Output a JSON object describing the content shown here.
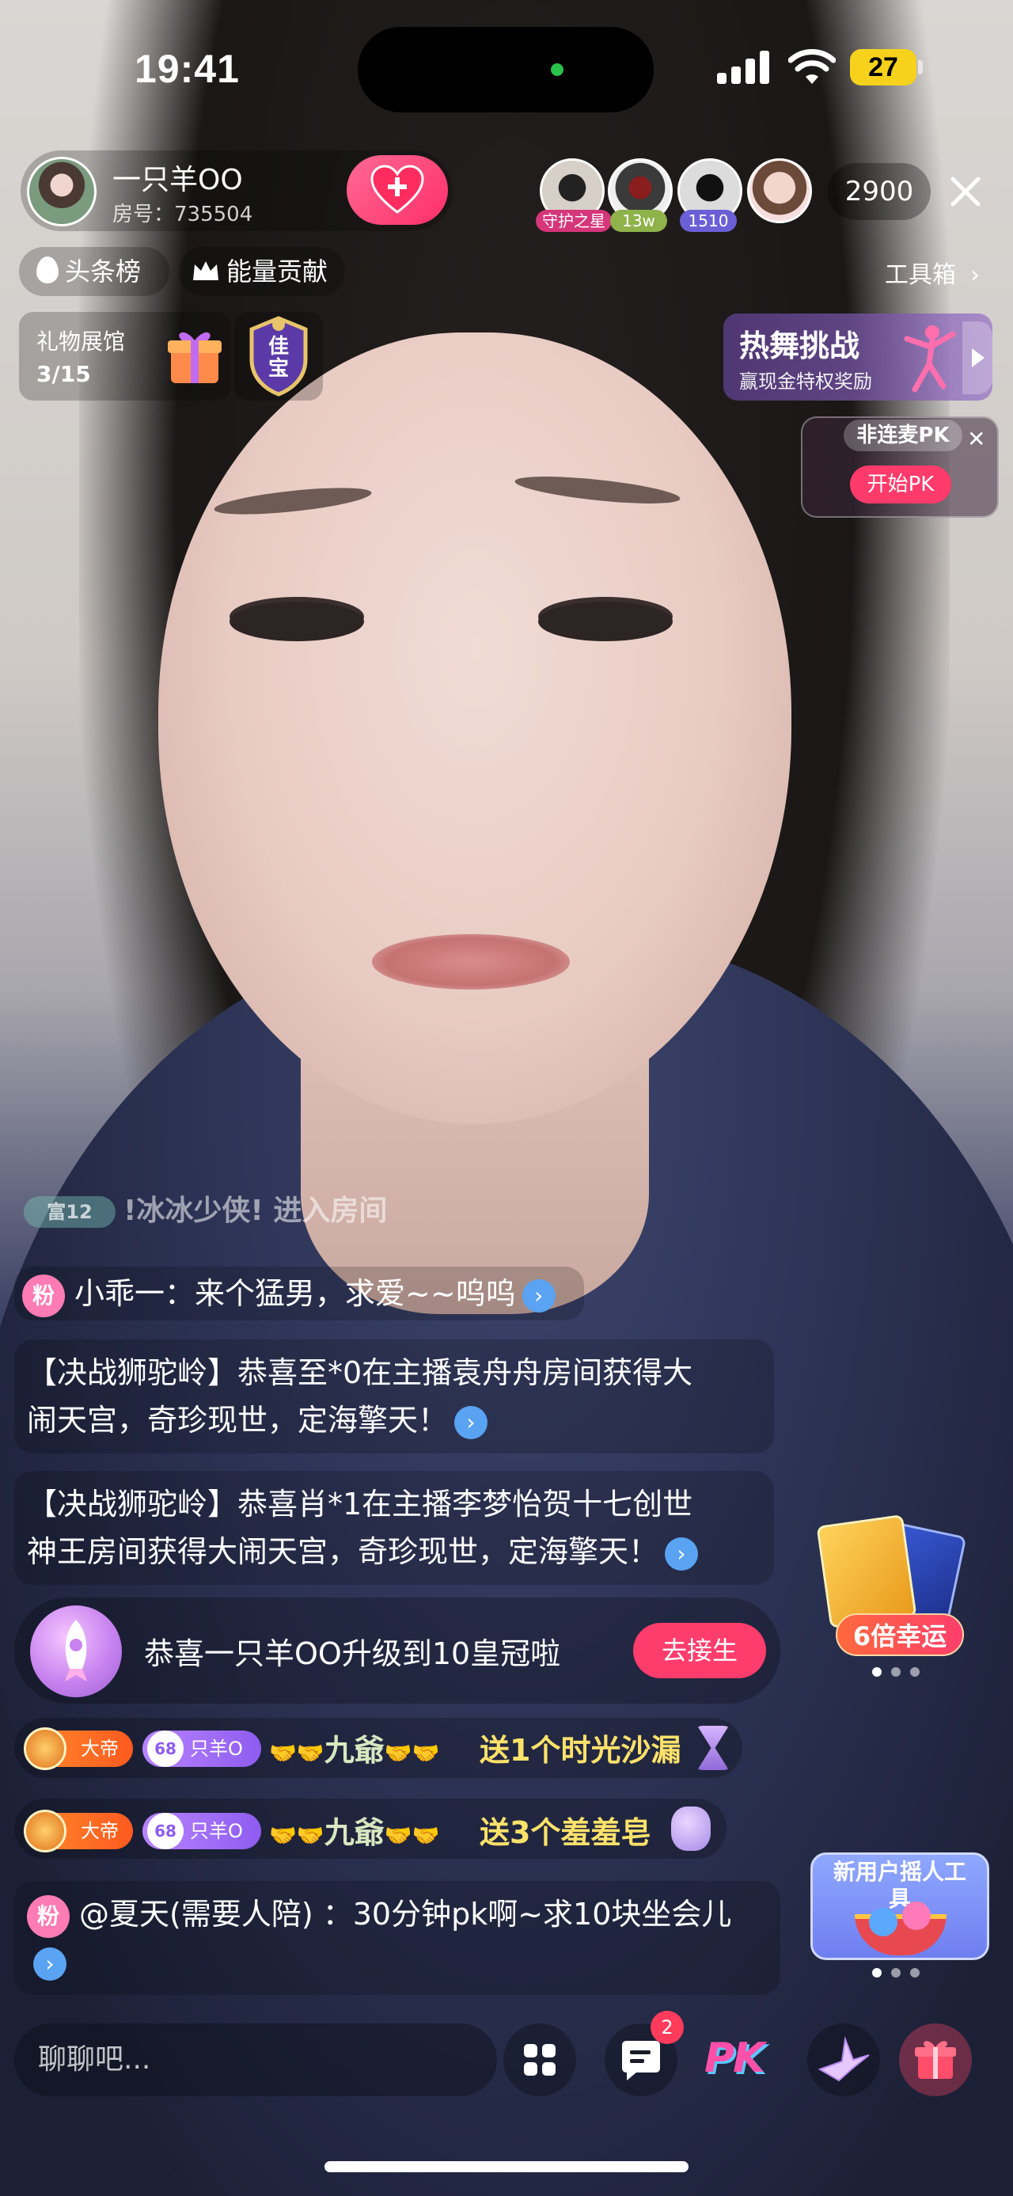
{
  "status_bar": {
    "time": "19:41",
    "battery": "27"
  },
  "host": {
    "name": "一只羊OO",
    "room_id": "房号：735504"
  },
  "viewers": {
    "badges": [
      "守护之星",
      "13w",
      "1510"
    ],
    "count": "2900"
  },
  "rank_chips": {
    "headline": "头条榜",
    "energy": "能量贡献",
    "toolbox": "工具箱"
  },
  "gift_gallery": {
    "title": "礼物展馆",
    "progress": "3/15",
    "badge_text": "佳宝"
  },
  "dance_challenge": {
    "title": "热舞挑战",
    "subtitle": "赢现金特权奖励"
  },
  "pk_card": {
    "title": "非连麦PK",
    "start": "开始PK"
  },
  "chat": {
    "enter": {
      "wealth_badge": "富12",
      "text": "!冰冰少侠! 进入房间"
    },
    "msg1": {
      "badge": "粉",
      "text": "小乖一：来个猛男，求爱~~呜呜"
    },
    "msg2": {
      "line1": "【决战狮驼岭】恭喜至*0在主播袁舟舟房间获得大",
      "line2": "闹天宫，奇珍现世，定海擎天！"
    },
    "msg3": {
      "line1": "【决战狮驼岭】恭喜肖*1在主播李梦怡贺十七创世",
      "line2": "神王房间获得大闹天宫，奇珍现世，定海擎天！"
    },
    "level_up": {
      "text": "恭喜一只羊OO升级到10皇冠啦",
      "button": "去接生"
    },
    "gift1": {
      "rank": "大帝",
      "fan_level": "68",
      "fan_name": "只羊O",
      "sender": "九爺",
      "gift": "送1个时光沙漏"
    },
    "gift2": {
      "rank": "大帝",
      "fan_level": "68",
      "fan_name": "只羊O",
      "sender": "九爺",
      "gift": "送3个羞羞皂"
    },
    "msg4": {
      "badge": "粉",
      "text": "@夏天(需要人陪) ：30分钟pk啊~求10块坐会儿"
    }
  },
  "lucky": {
    "label": "6倍幸运"
  },
  "new_user_tool": {
    "text": "新用户摇人工具"
  },
  "bottom_bar": {
    "placeholder": "聊聊吧...",
    "message_badge": "2",
    "pk_label": "PK"
  },
  "colors": {
    "accent": "#ff3d6c",
    "gift_text": "#ffe26a",
    "link_dot": "#5aa3f2"
  }
}
